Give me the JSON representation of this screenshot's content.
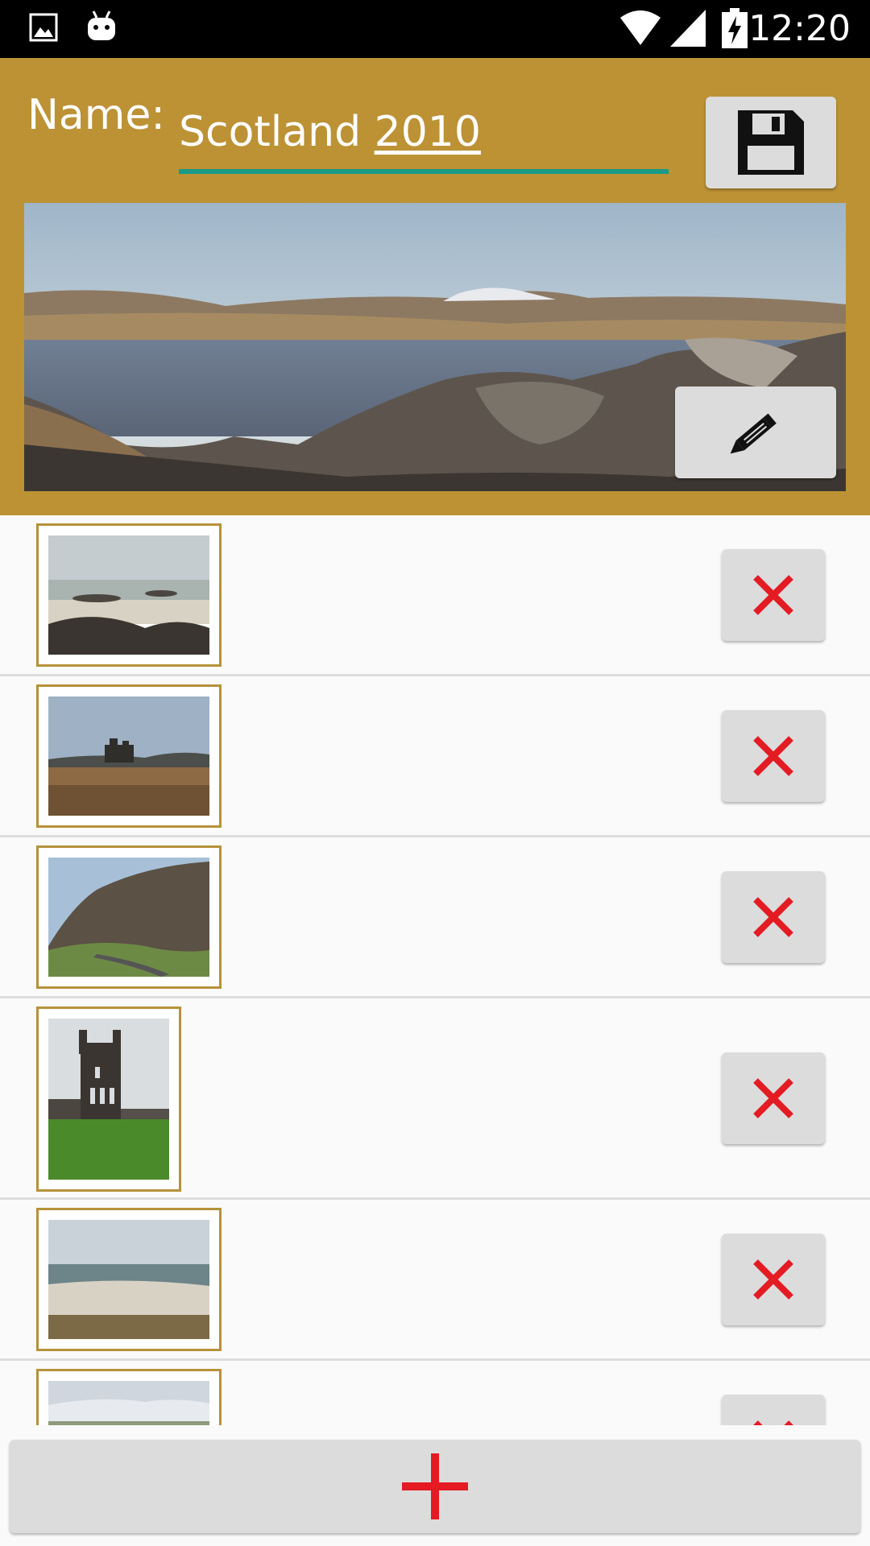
{
  "status_bar": {
    "time": "12:20",
    "icons": [
      "image-notification-icon",
      "android-icon",
      "wifi-icon",
      "signal-icon",
      "battery-charging-icon"
    ]
  },
  "header": {
    "name_label": "Name:",
    "name_value_prefix": "Scotland ",
    "name_value_underlined": "2010",
    "save_icon": "floppy-disk-icon",
    "edit_icon": "pencil-icon",
    "accent_color": "#bc9235",
    "input_underline_color": "#1a9a87"
  },
  "photos": [
    {
      "thumbnail": "rocky-beach-photo",
      "delete_icon": "close-icon"
    },
    {
      "thumbnail": "castle-moor-photo",
      "delete_icon": "close-icon"
    },
    {
      "thumbnail": "cliff-road-photo",
      "delete_icon": "close-icon"
    },
    {
      "thumbnail": "cathedral-ruin-photo",
      "delete_icon": "close-icon"
    },
    {
      "thumbnail": "sandy-beach-photo",
      "delete_icon": "close-icon"
    },
    {
      "thumbnail": "mountain-snow-photo",
      "delete_icon": "close-icon"
    }
  ],
  "add_button": {
    "icon": "plus-icon",
    "color": "#e41b23"
  }
}
